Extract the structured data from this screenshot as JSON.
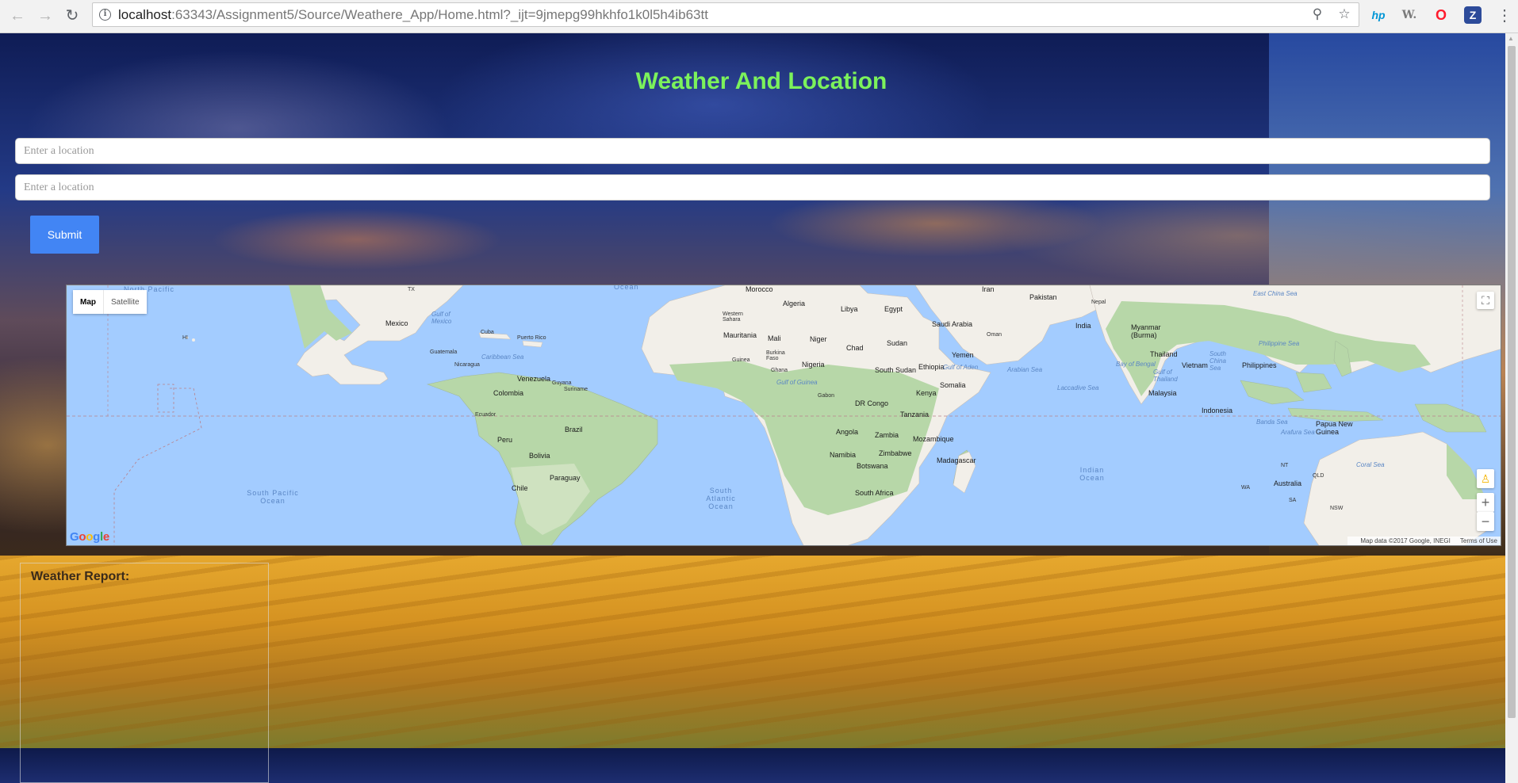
{
  "browser": {
    "url_host": "localhost",
    "url_rest": ":63343/Assignment5/Source/Weathere_App/Home.html?_ijt=9jmepg99hkhfo1k0l5h4ib63tt",
    "ext_hp": "hp",
    "ext_w": "W.",
    "ext_opera": "O",
    "ext_z": "Z"
  },
  "page": {
    "title": "Weather And Location",
    "input1_placeholder": "Enter a location",
    "input2_placeholder": "Enter a location",
    "submit_label": "Submit",
    "report_title": "Weather Report:"
  },
  "map": {
    "type_map": "Map",
    "type_satellite": "Satellite",
    "attribution": "Map data ©2017 Google, INEGI",
    "terms": "Terms of Use",
    "labels": {
      "ocean_top": "Ocean",
      "north_pacific": "North Pacific",
      "tx": "TX",
      "mexico": "Mexico",
      "gulf_mexico": "Gulf of Mexico",
      "cuba": "Cuba",
      "puerto_rico": "Puerto Rico",
      "hi": "HI",
      "guatemala": "Guatemala",
      "caribbean_sea": "Caribbean Sea",
      "nicaragua": "Nicaragua",
      "venezuela": "Venezuela",
      "guyana": "Guyana",
      "suriname": "Suriname",
      "colombia": "Colombia",
      "ecuador": "Ecuador",
      "peru": "Peru",
      "brazil": "Brazil",
      "bolivia": "Bolivia",
      "paraguay": "Paraguay",
      "chile": "Chile",
      "south_pacific": "South Pacific Ocean",
      "south_atlantic": "South Atlantic Ocean",
      "morocco": "Morocco",
      "algeria": "Algeria",
      "libya": "Libya",
      "egypt": "Egypt",
      "western_sahara": "Western Sahara",
      "mauritania": "Mauritania",
      "mali": "Mali",
      "niger": "Niger",
      "chad": "Chad",
      "sudan": "Sudan",
      "burkina_faso": "Burkina Faso",
      "nigeria": "Nigeria",
      "ghana": "Ghana",
      "guinea": "Guinea",
      "gulf_guinea": "Gulf of Guinea",
      "south_sudan": "South Sudan",
      "ethiopia": "Ethiopia",
      "somalia": "Somalia",
      "kenya": "Kenya",
      "gabon": "Gabon",
      "dr_congo": "DR Congo",
      "tanzania": "Tanzania",
      "angola": "Angola",
      "zambia": "Zambia",
      "mozambique": "Mozambique",
      "zimbabwe": "Zimbabwe",
      "namibia": "Namibia",
      "botswana": "Botswana",
      "madagascar": "Madagascar",
      "south_africa": "South Africa",
      "iran": "Iran",
      "saudi_arabia": "Saudi Arabia",
      "oman": "Oman",
      "yemen": "Yemen",
      "gulf_aden": "Gulf of Aden",
      "arabian_sea": "Arabian Sea",
      "pakistan": "Pakistan",
      "nepal": "Nepal",
      "india": "India",
      "bay_bengal": "Bay of Bengal",
      "laccadive_sea": "Laccadive Sea",
      "myanmar": "Myanmar (Burma)",
      "thailand": "Thailand",
      "vietnam": "Vietnam",
      "gulf_thailand": "Gulf of Thailand",
      "south_china_sea": "South China Sea",
      "east_china_sea": "East China Sea",
      "philippine_sea": "Philippine Sea",
      "philippines": "Philippines",
      "malaysia": "Malaysia",
      "indonesia": "Indonesia",
      "banda_sea": "Banda Sea",
      "arafura_sea": "Arafura Sea",
      "papua": "Papua New Guinea",
      "coral_sea": "Coral Sea",
      "indian_ocean": "Indian Ocean",
      "australia": "Australia",
      "nt": "NT",
      "qld": "QLD",
      "wa": "WA",
      "sa": "SA",
      "nsw": "NSW"
    }
  },
  "colors": {
    "title": "#7cf25b",
    "submit_bg": "#4285f4",
    "water": "#a3ccff",
    "land": "#f2efe9",
    "green_land": "#b7d7a8"
  }
}
